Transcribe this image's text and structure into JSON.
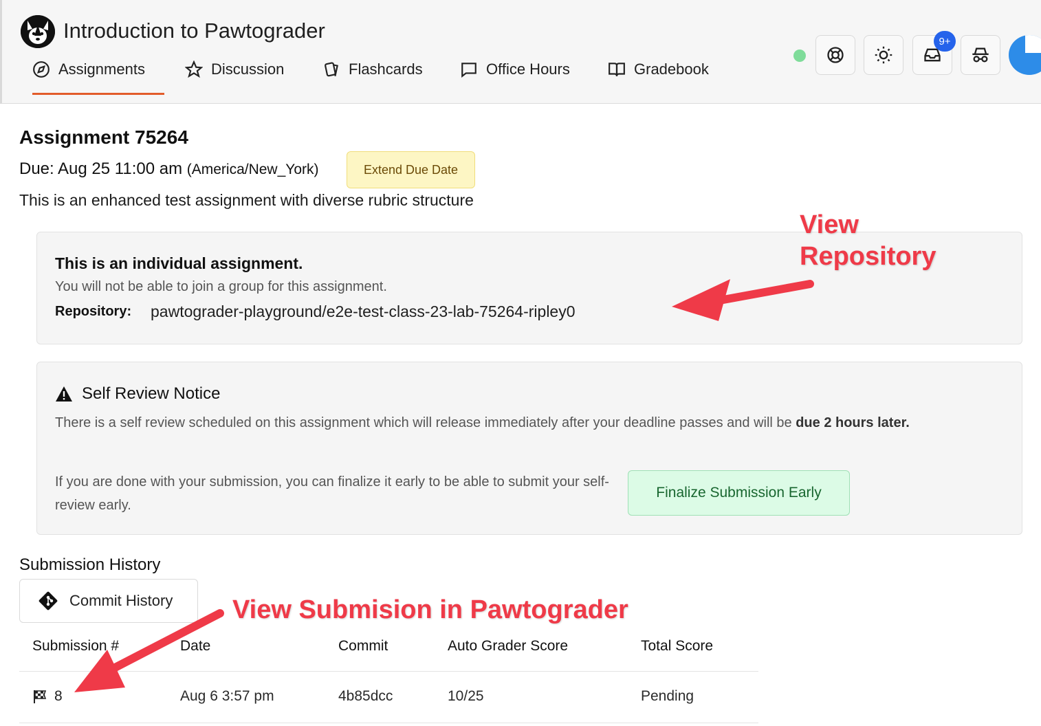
{
  "app": {
    "title": "Introduction to Pawtograder"
  },
  "nav": {
    "items": [
      {
        "label": "Assignments",
        "icon": "compass-icon",
        "active": true
      },
      {
        "label": "Discussion",
        "icon": "star-icon",
        "active": false
      },
      {
        "label": "Flashcards",
        "icon": "cards-icon",
        "active": false
      },
      {
        "label": "Office Hours",
        "icon": "chat-bubble-icon",
        "active": false
      },
      {
        "label": "Gradebook",
        "icon": "open-book-icon",
        "active": false
      }
    ]
  },
  "header_tools": {
    "status_color": "#7fdc9a",
    "notifications_badge": "9+",
    "icons": [
      "help-lifebuoy-icon",
      "theme-sun-icon",
      "inbox-icon",
      "incognito-icon"
    ]
  },
  "assignment": {
    "title": "Assignment 75264",
    "due_label": "Due: Aug 25 11:00 am",
    "due_timezone": "(America/New_York)",
    "extend_button": "Extend Due Date",
    "description": "This is an enhanced test assignment with diverse rubric structure"
  },
  "group_card": {
    "heading": "This is an individual assignment.",
    "subtext": "You will not be able to join a group for this assignment.",
    "repo_label": "Repository:",
    "repo_value": "pawtograder-playground/e2e-test-class-23-lab-75264-ripley0"
  },
  "self_review": {
    "title": "Self Review Notice",
    "text_prefix": "There is a self review scheduled on this assignment which will release immediately after your deadline passes and will be ",
    "text_bold": "due 2 hours later.",
    "finalize_text": "If you are done with your submission, you can finalize it early to be able to submit your self-review early.",
    "finalize_button": "Finalize Submission Early"
  },
  "history": {
    "title": "Submission History",
    "commit_history_button": "Commit History",
    "columns": [
      "Submission #",
      "Date",
      "Commit",
      "Auto Grader Score",
      "Total Score"
    ],
    "rows": [
      {
        "number": "8",
        "date": "Aug 6 3:57 pm",
        "commit": "4b85dcc",
        "auto_score": "10/25",
        "total": "Pending"
      }
    ]
  },
  "annotations": {
    "view_repository_line1": "View",
    "view_repository_line2": "Repository",
    "view_submission": "View Submision in Pawtograder",
    "color": "#ef3a48"
  }
}
